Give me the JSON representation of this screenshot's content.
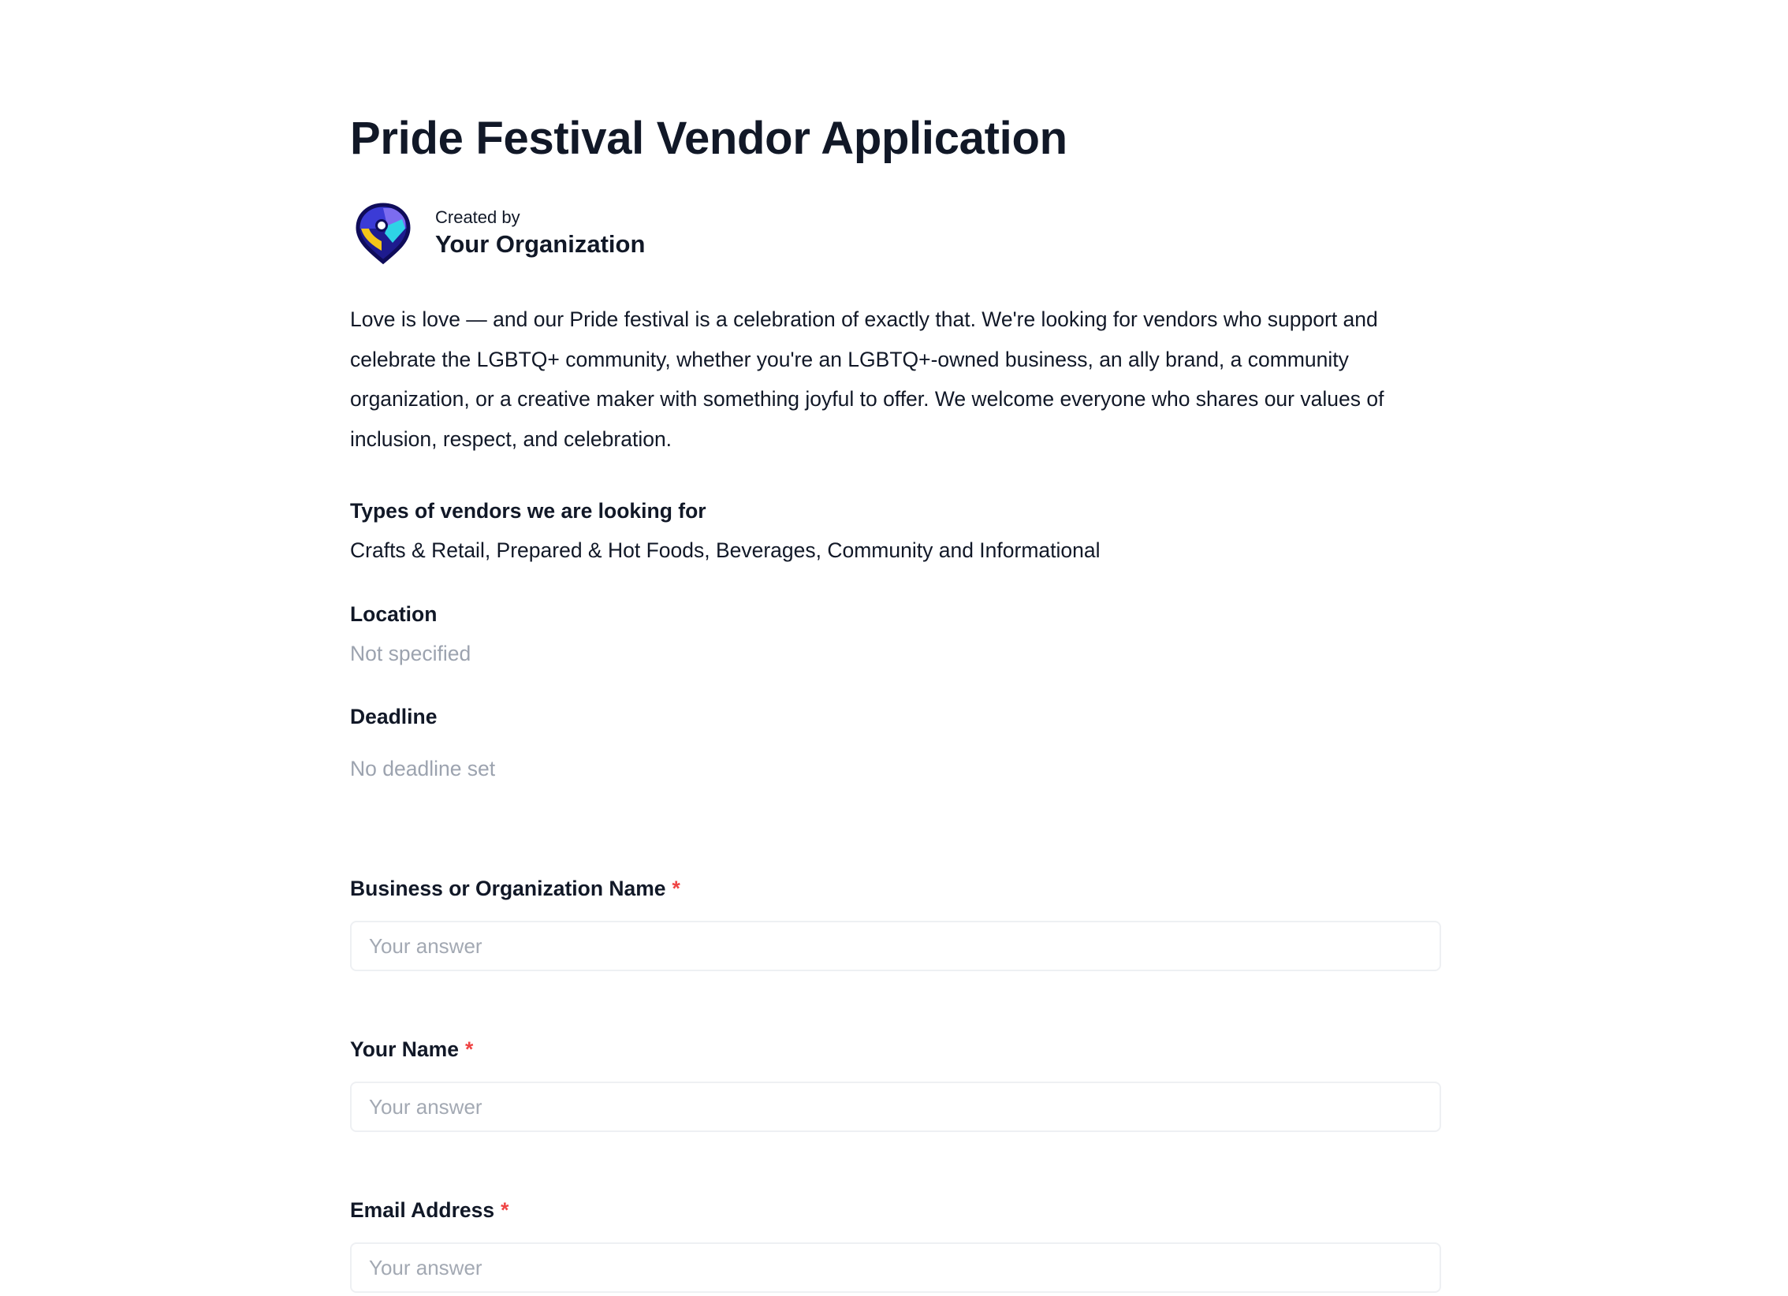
{
  "form": {
    "title": "Pride Festival Vendor Application",
    "created_by_label": "Created by",
    "organization": "Your Organization",
    "description": "Love is love — and our Pride festival is a celebration of exactly that. We're looking for vendors who support and celebrate the LGBTQ+ community, whether you're an LGBTQ+-owned business, an ally brand, a community organization, or a creative maker with something joyful to offer. We welcome everyone who shares our values of inclusion, respect, and celebration.",
    "vendor_types_label": "Types of vendors we are looking for",
    "vendor_types": "Crafts & Retail, Prepared & Hot Foods, Beverages, Community and Informational",
    "location_label": "Location",
    "location_value": "Not specified",
    "deadline_label": "Deadline",
    "deadline_value": "No deadline set"
  },
  "fields": [
    {
      "label": "Business or Organization Name",
      "required_mark": "*",
      "placeholder": "Your answer",
      "value": ""
    },
    {
      "label": "Your Name",
      "required_mark": "*",
      "placeholder": "Your answer",
      "value": ""
    },
    {
      "label": "Email Address",
      "required_mark": "*",
      "placeholder": "Your answer",
      "value": ""
    }
  ],
  "colors": {
    "text": "#111827",
    "muted": "#9ca3af",
    "required": "#ef4444",
    "input_border": "#eef0f3"
  },
  "icons": {
    "org_logo": "map-pin-heart-logo"
  }
}
